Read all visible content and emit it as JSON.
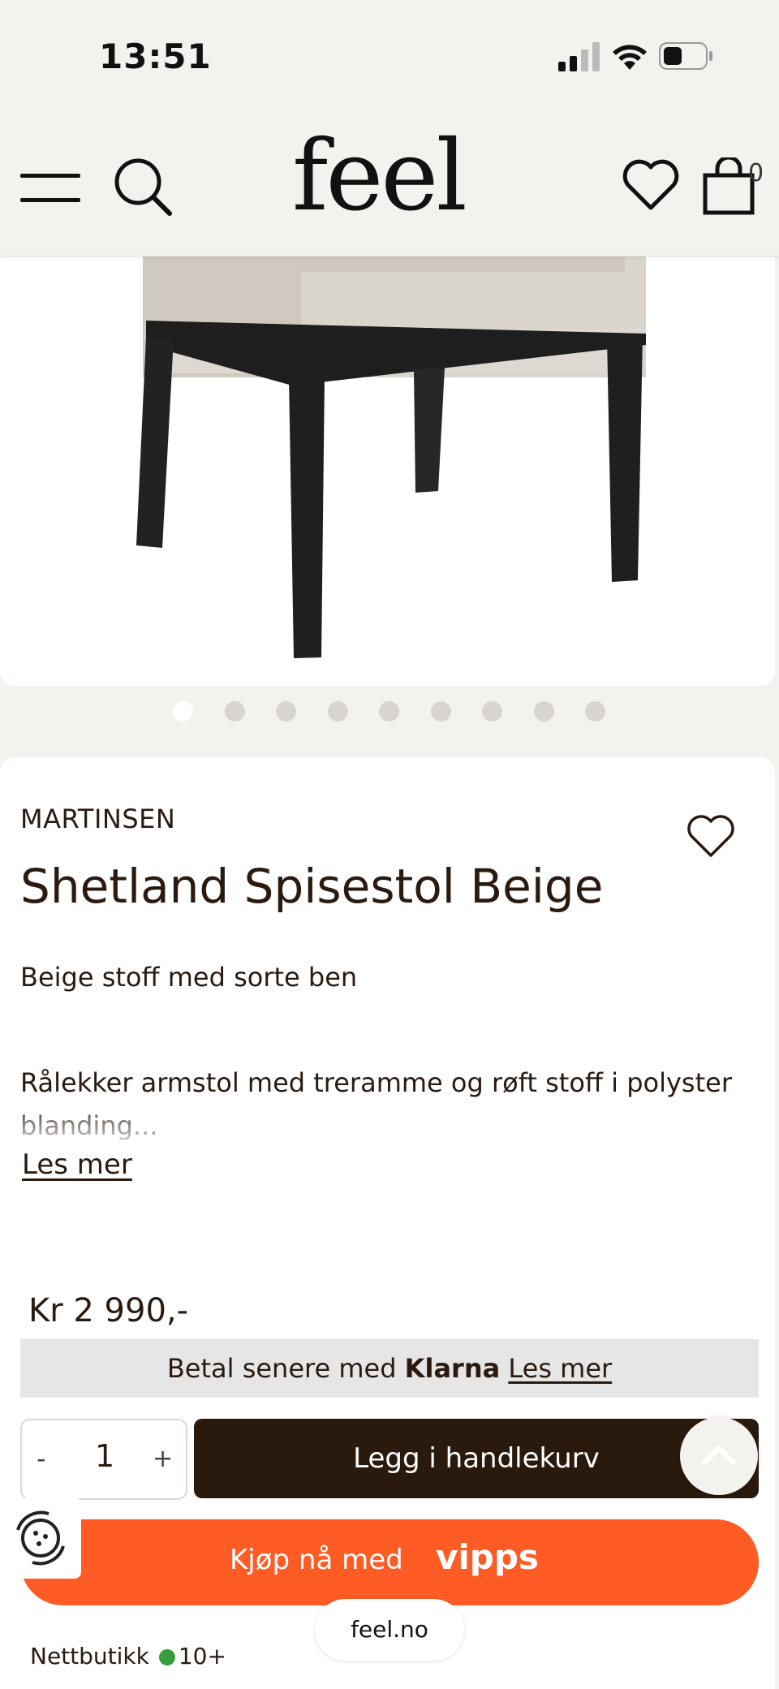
{
  "status_bar": {
    "time": "13:51"
  },
  "header": {
    "logo": "feel",
    "cart_count": "0"
  },
  "carousel": {
    "dot_count": 9,
    "active_index": 0
  },
  "product": {
    "brand": "MARTINSEN",
    "title": "Shetland Spisestol Beige",
    "subtitle": "Beige stoff med sorte ben",
    "description": "Rålekker armstol med treramme og røft stoff i polyster blanding...",
    "read_more": "Les mer",
    "price": "Kr 2 990,-"
  },
  "klarna": {
    "prefix": "Betal senere med",
    "brand": "Klarna",
    "link": "Les mer"
  },
  "quantity": {
    "minus": "-",
    "value": "1",
    "plus": "+"
  },
  "add_to_cart": "Legg i handlekurv",
  "vipps": {
    "label": "Kjøp nå med",
    "logo": "vipps"
  },
  "browser": {
    "url": "feel.no"
  },
  "footer": {
    "store_label": "Nettbutikk",
    "stock": "10+"
  },
  "colors": {
    "accent_dark": "#2a1a0e",
    "vipps_orange": "#ff5b24",
    "stock_green": "#3a9b3a"
  }
}
